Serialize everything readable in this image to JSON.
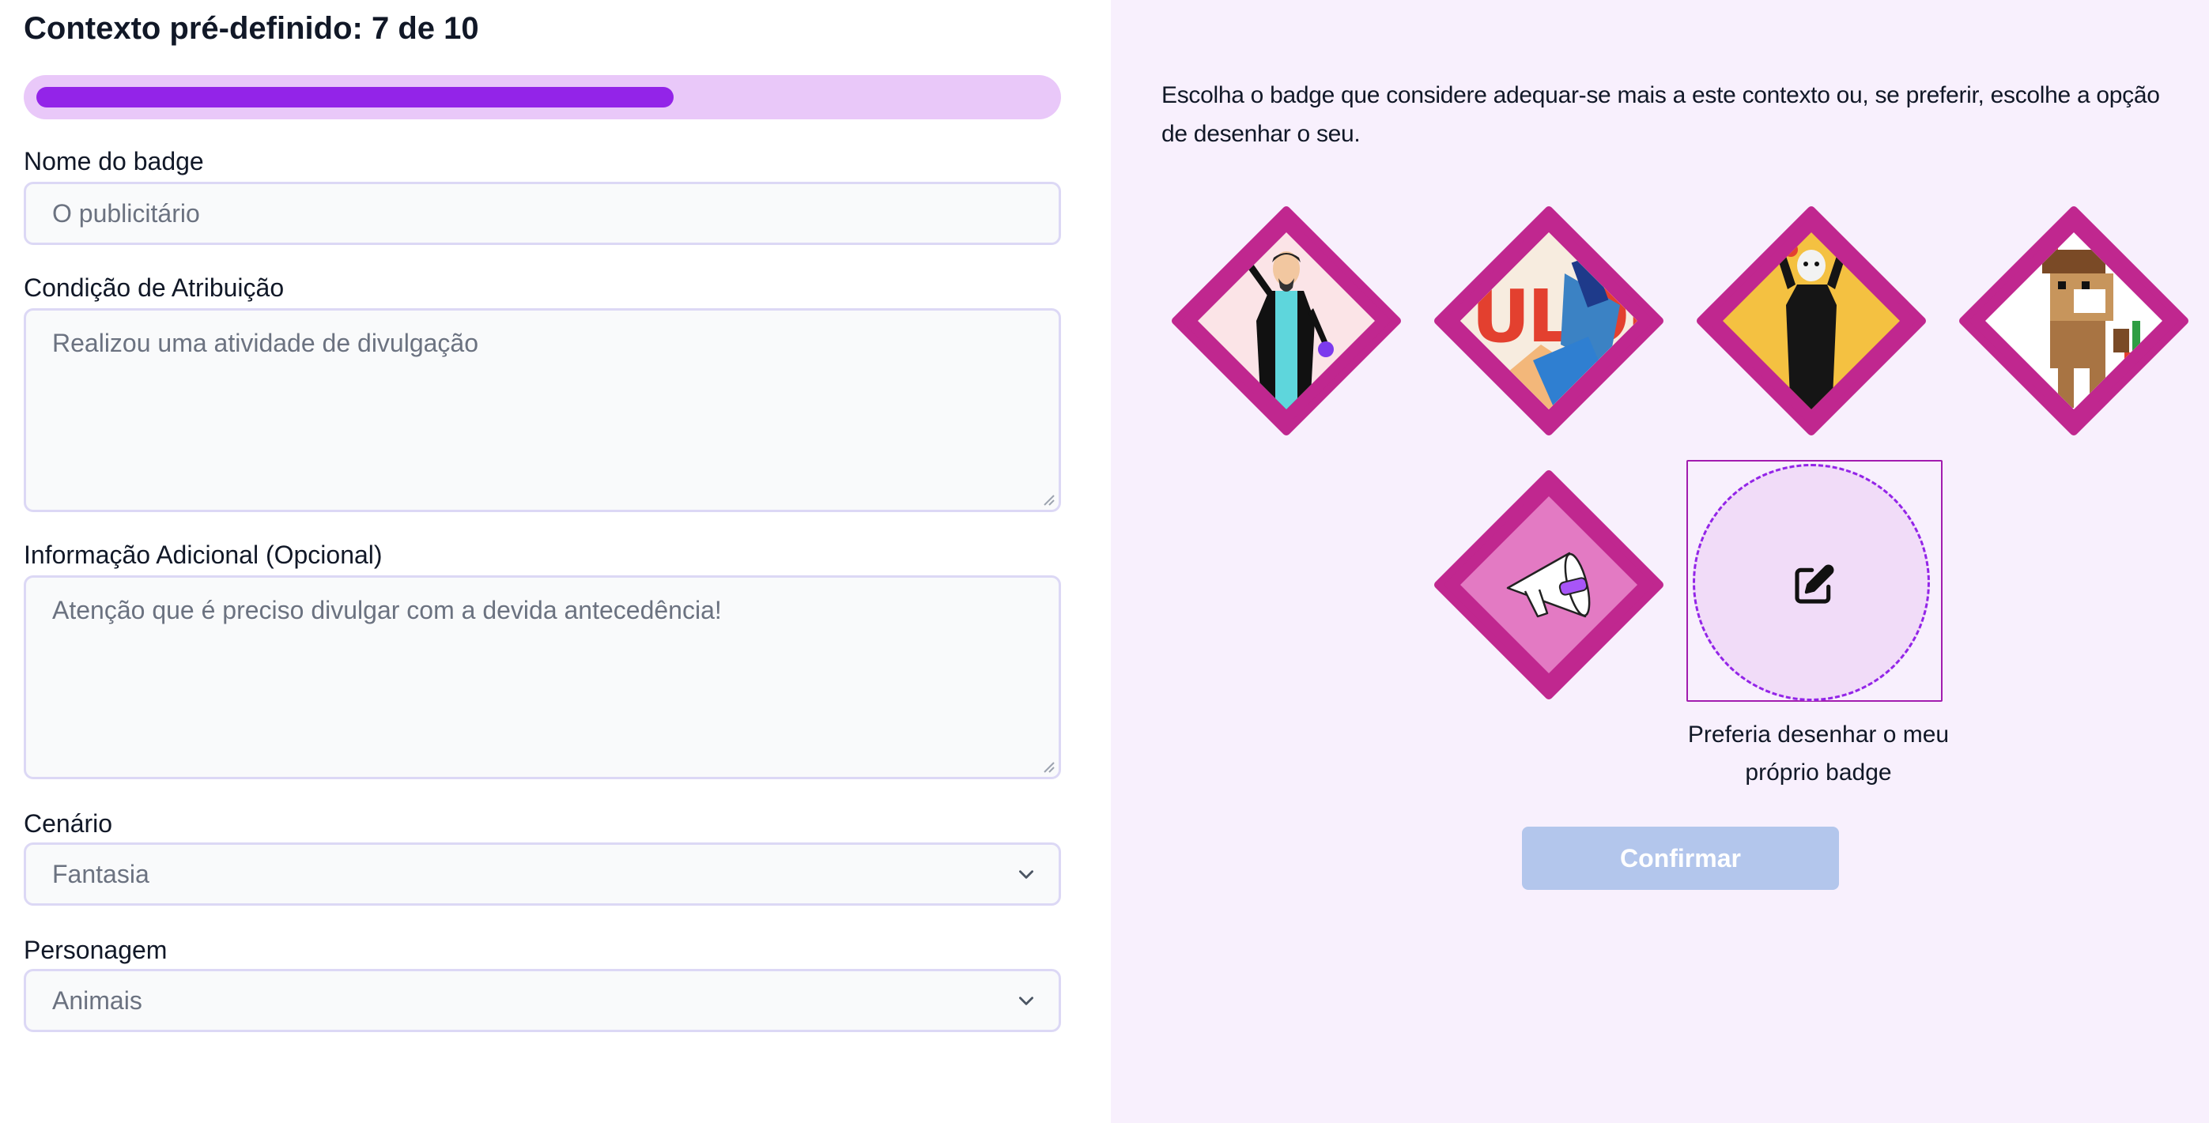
{
  "header": {
    "title": "Contexto pré-definido: 7 de 10",
    "progress": {
      "current": 7,
      "total": 10,
      "percent": 63
    }
  },
  "form": {
    "badge_name": {
      "label": "Nome do badge",
      "placeholder": "O publicitário"
    },
    "condition": {
      "label": "Condição de Atribuição",
      "placeholder": "Realizou uma atividade de divulgação"
    },
    "additional_info": {
      "label": "Informação Adicional (Opcional)",
      "placeholder": "Atenção que é preciso divulgar com a devida antecedência!"
    },
    "scenario": {
      "label": "Cenário",
      "selected": "Fantasia"
    },
    "character": {
      "label": "Personagem",
      "selected": "Animais"
    }
  },
  "panel": {
    "instruction": "Escolha o badge que considere adequar-se mais a este contexto ou, se preferir, escolhe a opção de desenhar o seu.",
    "badges": [
      {
        "icon": "magician-badge-icon"
      },
      {
        "icon": "collage-poster-badge-icon"
      },
      {
        "icon": "conductor-badge-icon"
      },
      {
        "icon": "pixel-camel-badge-icon"
      },
      {
        "icon": "megaphone-badge-icon"
      }
    ],
    "draw_option": {
      "label": "Preferia desenhar o meu próprio badge",
      "icon": "edit-pencil-icon"
    },
    "confirm_label": "Confirmar"
  },
  "colors": {
    "accent": "#9324e8",
    "progress_track": "#e9c8f9",
    "badge_border": "#c0278f",
    "panel_bg": "#f8f0fd",
    "confirm_disabled": "#b3c6ec"
  }
}
